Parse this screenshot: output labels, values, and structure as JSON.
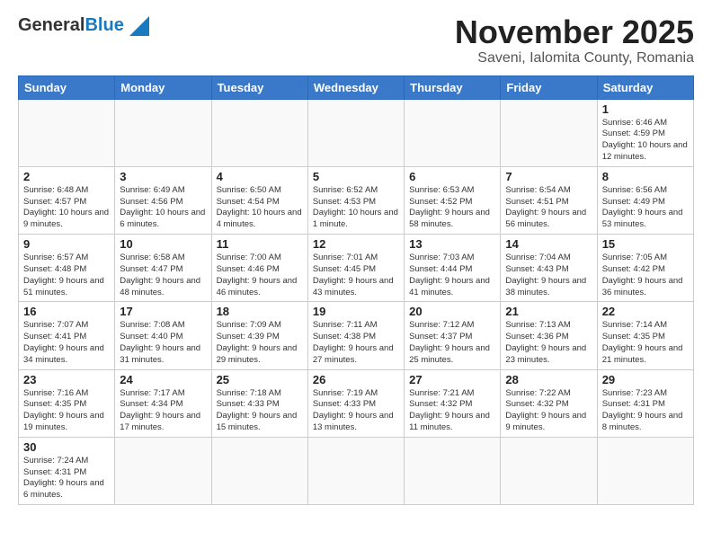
{
  "header": {
    "logo_general": "General",
    "logo_blue": "Blue",
    "title": "November 2025",
    "subtitle": "Saveni, Ialomita County, Romania"
  },
  "days_of_week": [
    "Sunday",
    "Monday",
    "Tuesday",
    "Wednesday",
    "Thursday",
    "Friday",
    "Saturday"
  ],
  "weeks": [
    [
      {
        "day": "",
        "info": ""
      },
      {
        "day": "",
        "info": ""
      },
      {
        "day": "",
        "info": ""
      },
      {
        "day": "",
        "info": ""
      },
      {
        "day": "",
        "info": ""
      },
      {
        "day": "",
        "info": ""
      },
      {
        "day": "1",
        "info": "Sunrise: 6:46 AM\nSunset: 4:59 PM\nDaylight: 10 hours and 12 minutes."
      }
    ],
    [
      {
        "day": "2",
        "info": "Sunrise: 6:48 AM\nSunset: 4:57 PM\nDaylight: 10 hours and 9 minutes."
      },
      {
        "day": "3",
        "info": "Sunrise: 6:49 AM\nSunset: 4:56 PM\nDaylight: 10 hours and 6 minutes."
      },
      {
        "day": "4",
        "info": "Sunrise: 6:50 AM\nSunset: 4:54 PM\nDaylight: 10 hours and 4 minutes."
      },
      {
        "day": "5",
        "info": "Sunrise: 6:52 AM\nSunset: 4:53 PM\nDaylight: 10 hours and 1 minute."
      },
      {
        "day": "6",
        "info": "Sunrise: 6:53 AM\nSunset: 4:52 PM\nDaylight: 9 hours and 58 minutes."
      },
      {
        "day": "7",
        "info": "Sunrise: 6:54 AM\nSunset: 4:51 PM\nDaylight: 9 hours and 56 minutes."
      },
      {
        "day": "8",
        "info": "Sunrise: 6:56 AM\nSunset: 4:49 PM\nDaylight: 9 hours and 53 minutes."
      }
    ],
    [
      {
        "day": "9",
        "info": "Sunrise: 6:57 AM\nSunset: 4:48 PM\nDaylight: 9 hours and 51 minutes."
      },
      {
        "day": "10",
        "info": "Sunrise: 6:58 AM\nSunset: 4:47 PM\nDaylight: 9 hours and 48 minutes."
      },
      {
        "day": "11",
        "info": "Sunrise: 7:00 AM\nSunset: 4:46 PM\nDaylight: 9 hours and 46 minutes."
      },
      {
        "day": "12",
        "info": "Sunrise: 7:01 AM\nSunset: 4:45 PM\nDaylight: 9 hours and 43 minutes."
      },
      {
        "day": "13",
        "info": "Sunrise: 7:03 AM\nSunset: 4:44 PM\nDaylight: 9 hours and 41 minutes."
      },
      {
        "day": "14",
        "info": "Sunrise: 7:04 AM\nSunset: 4:43 PM\nDaylight: 9 hours and 38 minutes."
      },
      {
        "day": "15",
        "info": "Sunrise: 7:05 AM\nSunset: 4:42 PM\nDaylight: 9 hours and 36 minutes."
      }
    ],
    [
      {
        "day": "16",
        "info": "Sunrise: 7:07 AM\nSunset: 4:41 PM\nDaylight: 9 hours and 34 minutes."
      },
      {
        "day": "17",
        "info": "Sunrise: 7:08 AM\nSunset: 4:40 PM\nDaylight: 9 hours and 31 minutes."
      },
      {
        "day": "18",
        "info": "Sunrise: 7:09 AM\nSunset: 4:39 PM\nDaylight: 9 hours and 29 minutes."
      },
      {
        "day": "19",
        "info": "Sunrise: 7:11 AM\nSunset: 4:38 PM\nDaylight: 9 hours and 27 minutes."
      },
      {
        "day": "20",
        "info": "Sunrise: 7:12 AM\nSunset: 4:37 PM\nDaylight: 9 hours and 25 minutes."
      },
      {
        "day": "21",
        "info": "Sunrise: 7:13 AM\nSunset: 4:36 PM\nDaylight: 9 hours and 23 minutes."
      },
      {
        "day": "22",
        "info": "Sunrise: 7:14 AM\nSunset: 4:35 PM\nDaylight: 9 hours and 21 minutes."
      }
    ],
    [
      {
        "day": "23",
        "info": "Sunrise: 7:16 AM\nSunset: 4:35 PM\nDaylight: 9 hours and 19 minutes."
      },
      {
        "day": "24",
        "info": "Sunrise: 7:17 AM\nSunset: 4:34 PM\nDaylight: 9 hours and 17 minutes."
      },
      {
        "day": "25",
        "info": "Sunrise: 7:18 AM\nSunset: 4:33 PM\nDaylight: 9 hours and 15 minutes."
      },
      {
        "day": "26",
        "info": "Sunrise: 7:19 AM\nSunset: 4:33 PM\nDaylight: 9 hours and 13 minutes."
      },
      {
        "day": "27",
        "info": "Sunrise: 7:21 AM\nSunset: 4:32 PM\nDaylight: 9 hours and 11 minutes."
      },
      {
        "day": "28",
        "info": "Sunrise: 7:22 AM\nSunset: 4:32 PM\nDaylight: 9 hours and 9 minutes."
      },
      {
        "day": "29",
        "info": "Sunrise: 7:23 AM\nSunset: 4:31 PM\nDaylight: 9 hours and 8 minutes."
      }
    ],
    [
      {
        "day": "30",
        "info": "Sunrise: 7:24 AM\nSunset: 4:31 PM\nDaylight: 9 hours and 6 minutes."
      },
      {
        "day": "",
        "info": ""
      },
      {
        "day": "",
        "info": ""
      },
      {
        "day": "",
        "info": ""
      },
      {
        "day": "",
        "info": ""
      },
      {
        "day": "",
        "info": ""
      },
      {
        "day": "",
        "info": ""
      }
    ]
  ]
}
